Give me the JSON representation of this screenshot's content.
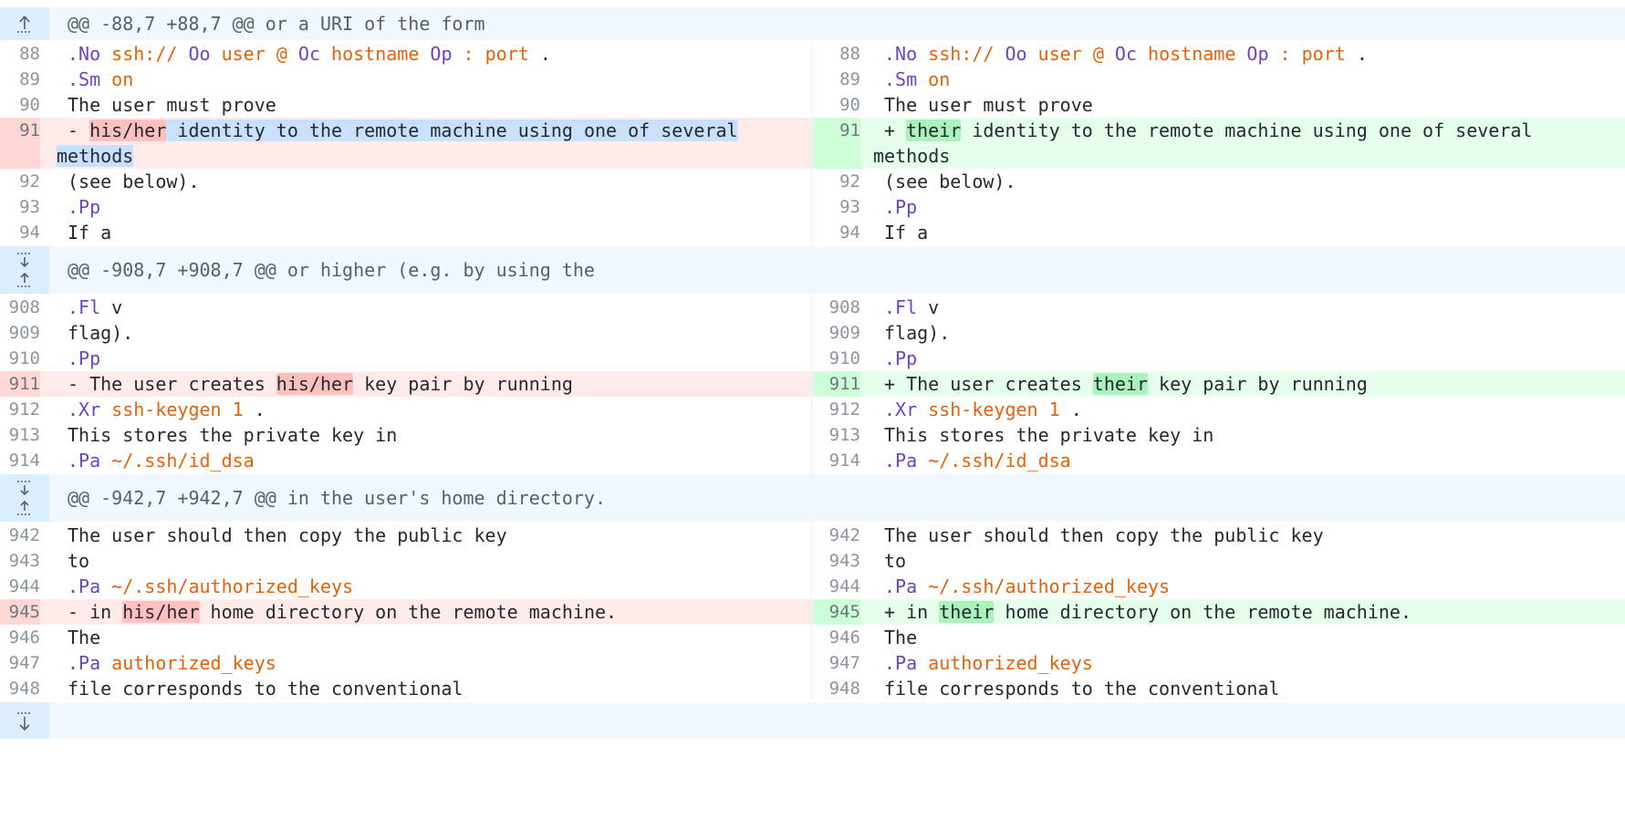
{
  "hunks": [
    {
      "header": "@@ -88,7 +88,7 @@ or a URI of the form"
    },
    {
      "header": "@@ -908,7 +908,7 @@ or higher (e.g. by using the"
    },
    {
      "header": "@@ -942,7 +942,7 @@ in the user's home directory."
    }
  ],
  "icons": {
    "expand_up": "expand-up-icon",
    "expand_down": "expand-down-icon",
    "expand_both": "expand-both-icon"
  },
  "lines": {
    "h1": [
      {
        "ln": "88",
        "segs": [
          [
            ".No ",
            "kw"
          ],
          [
            "ssh:// ",
            "str"
          ],
          [
            "Oo ",
            "kw"
          ],
          [
            "user ",
            "str"
          ],
          [
            "@ ",
            "str"
          ],
          [
            "Oc ",
            "kw"
          ],
          [
            "hostname ",
            "str"
          ],
          [
            "Op ",
            "kw"
          ],
          [
            ": ",
            "str"
          ],
          [
            "port",
            "str"
          ],
          [
            " .",
            ""
          ]
        ]
      },
      {
        "ln": "89",
        "segs": [
          [
            ".Sm ",
            "kw"
          ],
          [
            "on",
            "str"
          ]
        ]
      },
      {
        "ln": "90",
        "segs": [
          [
            "The user must prove",
            ""
          ]
        ]
      }
    ],
    "h1_changed": {
      "ln": "91",
      "left": {
        "prefix": "- ",
        "mark": "his/her",
        "rest": " identity to the remote machine using one of several",
        "cont": "methods"
      },
      "right": {
        "prefix": "+ ",
        "mark": "their",
        "rest": " identity to the remote machine using one of several",
        "cont": "methods"
      }
    },
    "h1_after": [
      {
        "ln": "92",
        "segs": [
          [
            "(see below).",
            ""
          ]
        ]
      },
      {
        "ln": "93",
        "segs": [
          [
            ".Pp",
            "kw"
          ]
        ]
      },
      {
        "ln": "94",
        "segs": [
          [
            "If a",
            ""
          ]
        ]
      }
    ],
    "h2": [
      {
        "ln": "908",
        "segs": [
          [
            ".Fl ",
            "kw"
          ],
          [
            "v",
            ""
          ]
        ]
      },
      {
        "ln": "909",
        "segs": [
          [
            "flag).",
            ""
          ]
        ]
      },
      {
        "ln": "910",
        "segs": [
          [
            ".Pp",
            "kw"
          ]
        ]
      }
    ],
    "h2_changed": {
      "ln": "911",
      "left": {
        "prefix": "- ",
        "before": "The user creates ",
        "mark": "his/her",
        "rest": " key pair by running"
      },
      "right": {
        "prefix": "+ ",
        "before": "The user creates ",
        "mark": "their",
        "rest": " key pair by running"
      }
    },
    "h2_after": [
      {
        "ln": "912",
        "segs": [
          [
            ".Xr ",
            "kw"
          ],
          [
            "ssh-keygen 1",
            "str"
          ],
          [
            " .",
            ""
          ]
        ]
      },
      {
        "ln": "913",
        "segs": [
          [
            "This stores the private key in",
            ""
          ]
        ]
      },
      {
        "ln": "914",
        "segs": [
          [
            ".Pa ",
            "kw"
          ],
          [
            "~/.ssh/id_dsa",
            "str"
          ]
        ]
      }
    ],
    "h3": [
      {
        "ln": "942",
        "segs": [
          [
            "The user should then copy the public key",
            ""
          ]
        ]
      },
      {
        "ln": "943",
        "segs": [
          [
            "to",
            ""
          ]
        ]
      },
      {
        "ln": "944",
        "segs": [
          [
            ".Pa ",
            "kw"
          ],
          [
            "~/.ssh/authorized_keys",
            "str"
          ]
        ]
      }
    ],
    "h3_changed": {
      "ln": "945",
      "left": {
        "prefix": "- ",
        "before": "in ",
        "mark": "his/her",
        "rest": " home directory on the remote machine."
      },
      "right": {
        "prefix": "+ ",
        "before": "in ",
        "mark": "their",
        "rest": " home directory on the remote machine."
      }
    },
    "h3_after": [
      {
        "ln": "946",
        "segs": [
          [
            "The",
            ""
          ]
        ]
      },
      {
        "ln": "947",
        "segs": [
          [
            ".Pa ",
            "kw"
          ],
          [
            "authorized_keys",
            "str"
          ]
        ]
      },
      {
        "ln": "948",
        "segs": [
          [
            "file corresponds to the conventional",
            ""
          ]
        ]
      }
    ]
  }
}
